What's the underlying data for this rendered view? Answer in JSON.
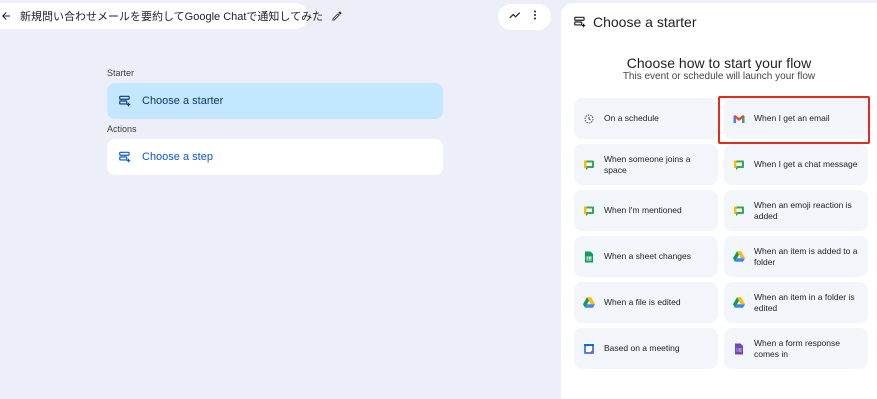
{
  "header": {
    "title": "新規問い合わせメールを要約してGoogle Chatで通知してみた"
  },
  "flow": {
    "starter_section": "Starter",
    "starter_card": "Choose a starter",
    "actions_section": "Actions",
    "step_card": "Choose a step"
  },
  "panel": {
    "title": "Choose a starter",
    "heading": "Choose how to start your flow",
    "subheading": "This event or schedule will launch your flow",
    "options": [
      {
        "label": "On a schedule",
        "icon": "clock-icon"
      },
      {
        "label": "When I get an email",
        "icon": "gmail-icon"
      },
      {
        "label": "When someone joins a space",
        "icon": "google-chat-icon"
      },
      {
        "label": "When I get a chat message",
        "icon": "google-chat-icon"
      },
      {
        "label": "When I'm mentioned",
        "icon": "google-chat-icon"
      },
      {
        "label": "When an emoji reaction is added",
        "icon": "google-chat-icon"
      },
      {
        "label": "When a sheet changes",
        "icon": "google-sheets-icon"
      },
      {
        "label": "When an item is added to a folder",
        "icon": "google-drive-icon"
      },
      {
        "label": "When a file is edited",
        "icon": "google-drive-icon"
      },
      {
        "label": "When an item in a folder is edited",
        "icon": "google-drive-icon"
      },
      {
        "label": "Based on a meeting",
        "icon": "google-calendar-icon"
      },
      {
        "label": "When a form response comes in",
        "icon": "google-forms-icon"
      }
    ]
  },
  "colors": {
    "accent": "#0b57d0",
    "selected_card": "#c2e7ff",
    "highlight_border": "#e12c1f"
  }
}
